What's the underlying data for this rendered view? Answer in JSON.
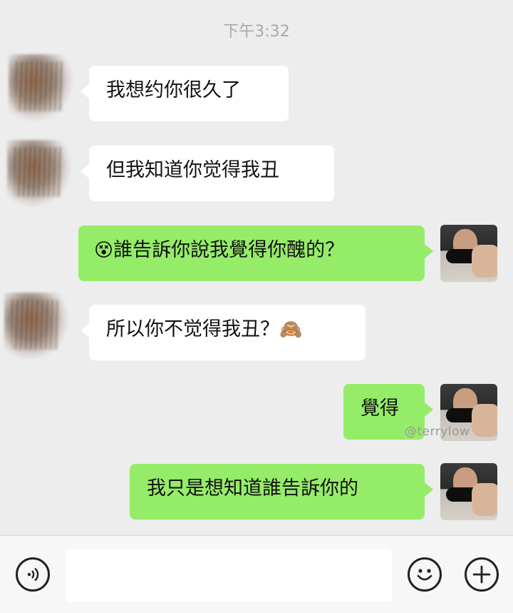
{
  "timestamp": "下午3:32",
  "messages": [
    {
      "side": "in",
      "text": "我想约你很久了"
    },
    {
      "side": "in",
      "text": "但我知道你觉得我丑"
    },
    {
      "side": "out",
      "emoji": "😵",
      "text": "誰告訴你說我覺得你醜的？"
    },
    {
      "side": "in",
      "text": "所以你不觉得我丑？",
      "emoji": "🙈"
    },
    {
      "side": "out",
      "text": "覺得"
    },
    {
      "side": "out",
      "text": "我只是想知道誰告訴你的"
    }
  ],
  "watermark": "@terrylow",
  "input": {
    "value": "",
    "placeholder": ""
  },
  "icons": {
    "voice": "voice-icon",
    "emoji": "smiley-icon",
    "add": "plus-icon"
  },
  "colors": {
    "outgoing_bubble": "#95ec69",
    "incoming_bubble": "#ffffff",
    "background": "#ededed"
  }
}
